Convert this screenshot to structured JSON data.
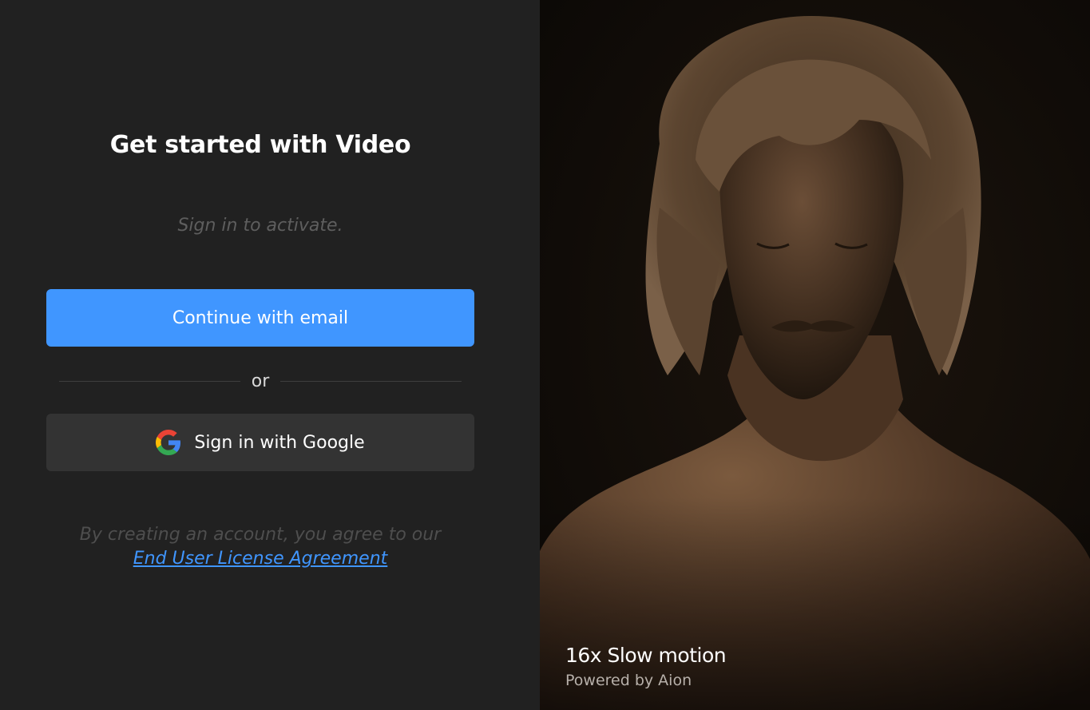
{
  "auth": {
    "title": "Get started with Video",
    "subtitle": "Sign in to activate.",
    "email_button_label": "Continue with email",
    "divider_label": "or",
    "google_button_label": "Sign in with Google",
    "google_icon": "google-icon",
    "legal_text": "By creating an account, you agree to our",
    "legal_link_label": "End User License Agreement"
  },
  "hero": {
    "image_icon": "portrait-photo",
    "caption_title": "16x Slow motion",
    "caption_subtitle": "Powered by Aion"
  },
  "colors": {
    "background": "#212121",
    "primary_button": "#4096ff",
    "secondary_button": "#333333",
    "link": "#4096ff"
  }
}
